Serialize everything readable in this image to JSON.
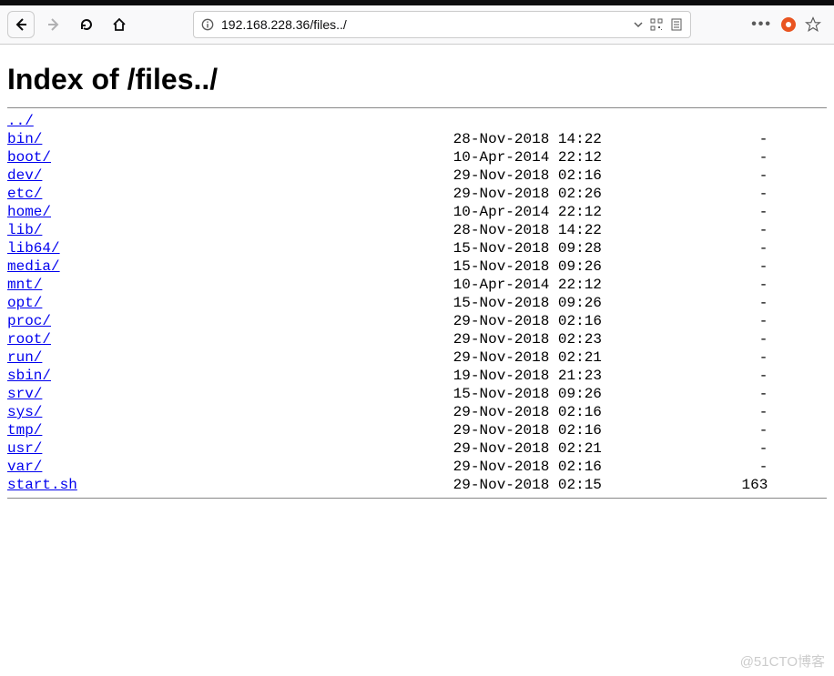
{
  "url": "192.168.228.36/files../",
  "heading": "Index of /files../",
  "parent_link": "../",
  "entries": [
    {
      "name": "bin/",
      "date": "28-Nov-2018 14:22",
      "size": "-"
    },
    {
      "name": "boot/",
      "date": "10-Apr-2014 22:12",
      "size": "-"
    },
    {
      "name": "dev/",
      "date": "29-Nov-2018 02:16",
      "size": "-"
    },
    {
      "name": "etc/",
      "date": "29-Nov-2018 02:26",
      "size": "-"
    },
    {
      "name": "home/",
      "date": "10-Apr-2014 22:12",
      "size": "-"
    },
    {
      "name": "lib/",
      "date": "28-Nov-2018 14:22",
      "size": "-"
    },
    {
      "name": "lib64/",
      "date": "15-Nov-2018 09:28",
      "size": "-"
    },
    {
      "name": "media/",
      "date": "15-Nov-2018 09:26",
      "size": "-"
    },
    {
      "name": "mnt/",
      "date": "10-Apr-2014 22:12",
      "size": "-"
    },
    {
      "name": "opt/",
      "date": "15-Nov-2018 09:26",
      "size": "-"
    },
    {
      "name": "proc/",
      "date": "29-Nov-2018 02:16",
      "size": "-"
    },
    {
      "name": "root/",
      "date": "29-Nov-2018 02:23",
      "size": "-"
    },
    {
      "name": "run/",
      "date": "29-Nov-2018 02:21",
      "size": "-"
    },
    {
      "name": "sbin/",
      "date": "19-Nov-2018 21:23",
      "size": "-"
    },
    {
      "name": "srv/",
      "date": "15-Nov-2018 09:26",
      "size": "-"
    },
    {
      "name": "sys/",
      "date": "29-Nov-2018 02:16",
      "size": "-"
    },
    {
      "name": "tmp/",
      "date": "29-Nov-2018 02:16",
      "size": "-"
    },
    {
      "name": "usr/",
      "date": "29-Nov-2018 02:21",
      "size": "-"
    },
    {
      "name": "var/",
      "date": "29-Nov-2018 02:16",
      "size": "-"
    },
    {
      "name": "start.sh",
      "date": "29-Nov-2018 02:15",
      "size": "163"
    }
  ],
  "watermark": "@51CTO博客"
}
